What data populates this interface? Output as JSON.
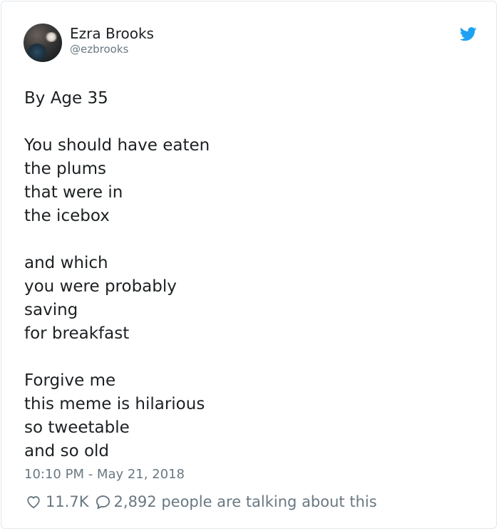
{
  "author": {
    "name": "Ezra Brooks",
    "handle": "@ezbrooks"
  },
  "tweet": {
    "lines": [
      "By Age 35",
      "",
      "You should have eaten",
      "the plums",
      "that were in",
      "the icebox",
      "",
      "and which",
      "you were probably",
      "saving",
      "for breakfast",
      "",
      "Forgive me",
      "this meme is hilarious",
      "so tweetable",
      "and so old"
    ],
    "timestamp": "10:10 PM - May 21, 2018"
  },
  "actions": {
    "likes": "11.7K",
    "talking": "2,892 people are talking about this"
  },
  "colors": {
    "twitter_blue": "#1da1f2",
    "muted_text": "#697882",
    "main_text": "#1c2022",
    "border": "#e1e8ed"
  },
  "icons": {
    "brand": "twitter-bird-icon",
    "like": "heart-icon",
    "reply": "speech-bubble-icon"
  }
}
